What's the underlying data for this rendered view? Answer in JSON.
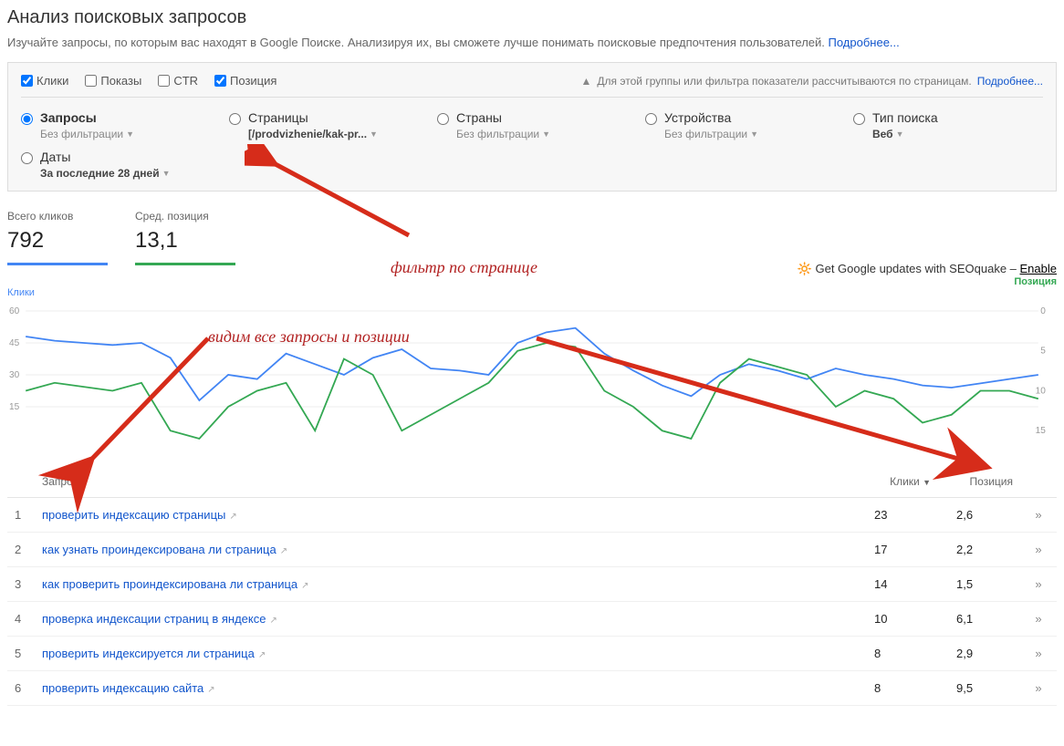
{
  "header": {
    "title": "Анализ поисковых запросов",
    "description": "Изучайте запросы, по которым вас находят в Google Поиске. Анализируя их, вы сможете лучше понимать поисковые предпочтения пользователей. ",
    "more_link": "Подробнее..."
  },
  "metrics": {
    "clicks": "Клики",
    "impressions": "Показы",
    "ctr": "CTR",
    "position": "Позиция",
    "clicks_checked": true,
    "impressions_checked": false,
    "ctr_checked": false,
    "position_checked": true
  },
  "notice": {
    "text": "Для этой группы или фильтра показатели рассчитываются по страницам.",
    "link": "Подробнее..."
  },
  "filters": {
    "queries": {
      "label": "Запросы",
      "sub": "Без фильтрации"
    },
    "pages": {
      "label": "Страницы",
      "sub": "[/prodvizhenie/kak-pr..."
    },
    "countries": {
      "label": "Страны",
      "sub": "Без фильтрации"
    },
    "devices": {
      "label": "Устройства",
      "sub": "Без фильтрации"
    },
    "search_type": {
      "label": "Тип поиска",
      "sub": "Веб"
    },
    "dates": {
      "label": "Даты",
      "sub": "За последние 28 дней"
    }
  },
  "stats": {
    "clicks_label": "Всего кликов",
    "clicks_value": "792",
    "position_label": "Сред. позиция",
    "position_value": "13,1"
  },
  "seoquake": {
    "text": "Get Google updates with SEOquake – ",
    "link": "Enable",
    "sub": "Позиция"
  },
  "chart_axis": {
    "left": "Клики",
    "right": ""
  },
  "chart_data": {
    "type": "line",
    "y_left_ticks": [
      60,
      45,
      30,
      15
    ],
    "y_right_ticks": [
      0,
      5,
      10,
      15
    ],
    "series": [
      {
        "name": "Клики",
        "axis": "left",
        "values": [
          48,
          46,
          45,
          44,
          45,
          38,
          18,
          30,
          28,
          40,
          35,
          30,
          38,
          42,
          33,
          32,
          30,
          45,
          50,
          52,
          40,
          32,
          25,
          20,
          30,
          35,
          32,
          28,
          33,
          30,
          28,
          25,
          24,
          26,
          28,
          30
        ]
      },
      {
        "name": "Позиция",
        "axis": "right",
        "values": [
          10,
          9,
          9.5,
          10,
          9,
          15,
          16,
          12,
          10,
          9,
          15,
          6,
          8,
          15,
          13,
          11,
          9,
          5,
          4,
          4.5,
          10,
          12,
          15,
          16,
          9,
          6,
          7,
          8,
          12,
          10,
          11,
          14,
          13,
          10,
          10,
          11
        ]
      }
    ]
  },
  "annotations": {
    "filter_page": "фильтр по странице",
    "see_all": "видим все запросы и позиции"
  },
  "table": {
    "cols": {
      "queries": "Запросы",
      "clicks": "Клики",
      "position": "Позиция"
    },
    "rows": [
      {
        "idx": "1",
        "query": "проверить индексацию страницы",
        "clicks": "23",
        "position": "2,6"
      },
      {
        "idx": "2",
        "query": "как узнать проиндексирована ли страница",
        "clicks": "17",
        "position": "2,2"
      },
      {
        "idx": "3",
        "query": "как проверить проиндексирована ли страница",
        "clicks": "14",
        "position": "1,5"
      },
      {
        "idx": "4",
        "query": "проверка индексации страниц в яндексе",
        "clicks": "10",
        "position": "6,1"
      },
      {
        "idx": "5",
        "query": "проверить индексируется ли страница",
        "clicks": "8",
        "position": "2,9"
      },
      {
        "idx": "6",
        "query": "проверить индексацию сайта",
        "clicks": "8",
        "position": "9,5"
      }
    ]
  }
}
